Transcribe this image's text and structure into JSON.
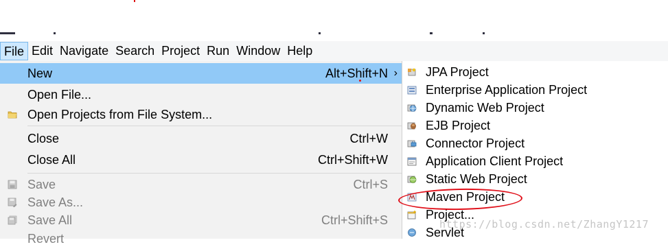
{
  "menubar": {
    "items": [
      "File",
      "Edit",
      "Navigate",
      "Search",
      "Project",
      "Run",
      "Window",
      "Help"
    ]
  },
  "file_menu": {
    "new": {
      "label": "New",
      "shortcut": "Alt+Shift+N",
      "arrow": "›"
    },
    "open_file": {
      "label": "Open File..."
    },
    "open_projects": {
      "label": "Open Projects from File System..."
    },
    "close": {
      "label": "Close",
      "shortcut": "Ctrl+W"
    },
    "close_all": {
      "label": "Close All",
      "shortcut": "Ctrl+Shift+W"
    },
    "save": {
      "label": "Save",
      "shortcut": "Ctrl+S"
    },
    "save_as": {
      "label": "Save As..."
    },
    "save_all": {
      "label": "Save All",
      "shortcut": "Ctrl+Shift+S"
    },
    "revert": {
      "label": "Revert"
    }
  },
  "new_submenu": {
    "items": [
      {
        "label": "JPA Project",
        "icon": "jpa-project-icon"
      },
      {
        "label": "Enterprise Application Project",
        "icon": "enterprise-project-icon"
      },
      {
        "label": "Dynamic Web Project",
        "icon": "web-project-icon"
      },
      {
        "label": "EJB Project",
        "icon": "ejb-project-icon"
      },
      {
        "label": "Connector Project",
        "icon": "connector-project-icon"
      },
      {
        "label": "Application Client Project",
        "icon": "app-client-project-icon"
      },
      {
        "label": "Static Web Project",
        "icon": "static-web-project-icon"
      },
      {
        "label": "Maven Project",
        "icon": "maven-project-icon"
      },
      {
        "label": "Project...",
        "icon": "project-icon"
      },
      {
        "label": "Servlet",
        "icon": "servlet-icon"
      }
    ]
  },
  "watermark": "https://blog.csdn.net/ZhangY1217",
  "colors": {
    "highlight": "#91c9f7",
    "menu_bg": "#f2f2f2",
    "annotation": "#e0101a"
  }
}
